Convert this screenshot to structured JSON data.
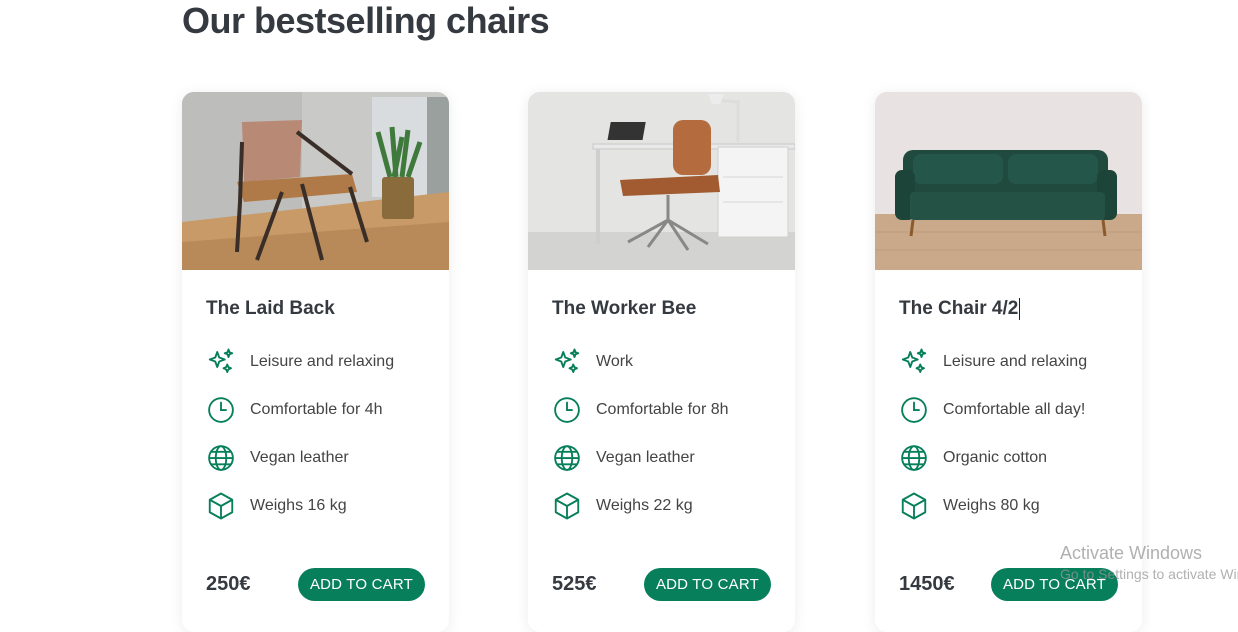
{
  "section": {
    "title": "Our bestselling chairs"
  },
  "theme": {
    "accent": "#087f5b",
    "text": "#343a40"
  },
  "products": [
    {
      "title": "The Laid Back",
      "image": "lounge-chair-photo",
      "attributes": [
        {
          "icon": "sparkles-icon",
          "text": "Leisure and relaxing"
        },
        {
          "icon": "clock-icon",
          "text": "Comfortable for 4h"
        },
        {
          "icon": "globe-icon",
          "text": "Vegan leather"
        },
        {
          "icon": "cube-icon",
          "text": "Weighs 16 kg"
        }
      ],
      "price": "250€",
      "cta": "ADD TO CART"
    },
    {
      "title": "The Worker Bee",
      "image": "office-chair-photo",
      "attributes": [
        {
          "icon": "sparkles-icon",
          "text": "Work"
        },
        {
          "icon": "clock-icon",
          "text": "Comfortable for 8h"
        },
        {
          "icon": "globe-icon",
          "text": "Vegan leather"
        },
        {
          "icon": "cube-icon",
          "text": "Weighs 22 kg"
        }
      ],
      "price": "525€",
      "cta": "ADD TO CART"
    },
    {
      "title": "The Chair 4/2",
      "image": "green-sofa-photo",
      "attributes": [
        {
          "icon": "sparkles-icon",
          "text": "Leisure and relaxing"
        },
        {
          "icon": "clock-icon",
          "text": "Comfortable all day!"
        },
        {
          "icon": "globe-icon",
          "text": "Organic cotton"
        },
        {
          "icon": "cube-icon",
          "text": "Weighs 80 kg"
        }
      ],
      "price": "1450€",
      "cta": "ADD TO CART"
    }
  ],
  "watermark": {
    "title": "Activate Windows",
    "subtitle": "Go to Settings to activate Windows."
  }
}
